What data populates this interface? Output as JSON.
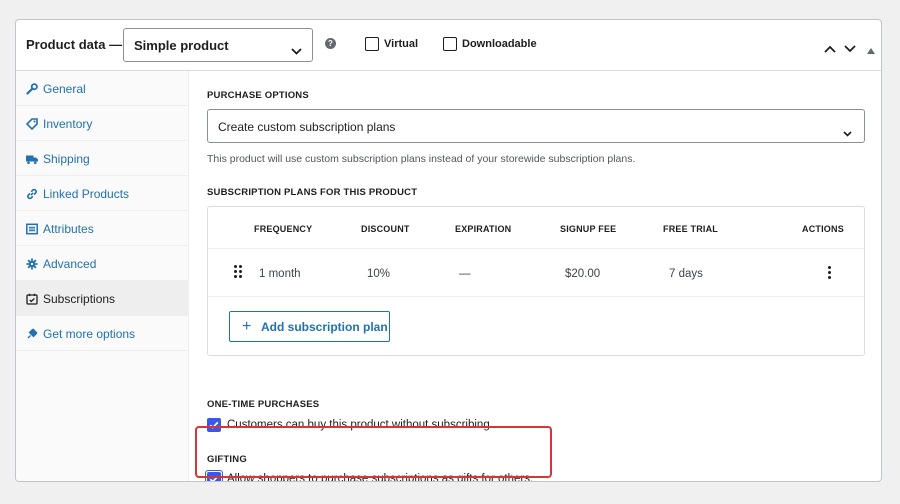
{
  "header": {
    "title": "Product data —",
    "product_type": "Simple product",
    "help_icon": "question-circle-icon",
    "virtual_label": "Virtual",
    "downloadable_label": "Downloadable",
    "virtual_checked": false,
    "downloadable_checked": false
  },
  "sidebar": {
    "items": [
      {
        "label": "General",
        "icon": "wrench-icon"
      },
      {
        "label": "Inventory",
        "icon": "tag-icon"
      },
      {
        "label": "Shipping",
        "icon": "truck-icon"
      },
      {
        "label": "Linked Products",
        "icon": "link-icon"
      },
      {
        "label": "Attributes",
        "icon": "list-icon"
      },
      {
        "label": "Advanced",
        "icon": "gear-icon"
      },
      {
        "label": "Subscriptions",
        "icon": "calendar-check-icon",
        "active": true
      },
      {
        "label": "Get more options",
        "icon": "plugin-icon"
      }
    ]
  },
  "main": {
    "purchase_options": {
      "label": "PURCHASE OPTIONS",
      "selected": "Create custom subscription plans",
      "help": "This product will use custom subscription plans instead of your storewide subscription plans."
    },
    "plans": {
      "label": "SUBSCRIPTION PLANS FOR THIS PRODUCT",
      "columns": [
        "FREQUENCY",
        "DISCOUNT",
        "EXPIRATION",
        "SIGNUP FEE",
        "FREE TRIAL",
        "ACTIONS"
      ],
      "rows": [
        {
          "frequency": "1 month",
          "discount": "10%",
          "expiration": "—",
          "signup_fee": "$20.00",
          "free_trial": "7 days"
        }
      ],
      "add_button": "Add subscription plan"
    },
    "one_time": {
      "label": "ONE-TIME PURCHASES",
      "checkbox_label": "Customers can buy this product without subscribing",
      "checked": true
    },
    "gifting": {
      "label": "GIFTING",
      "checkbox_label": "Allow shoppers to purchase subscriptions as gifts for others.",
      "checked": true
    }
  },
  "colors": {
    "accent": "#2271b1",
    "checkbox": "#3858e9",
    "highlight": "#d63638"
  }
}
